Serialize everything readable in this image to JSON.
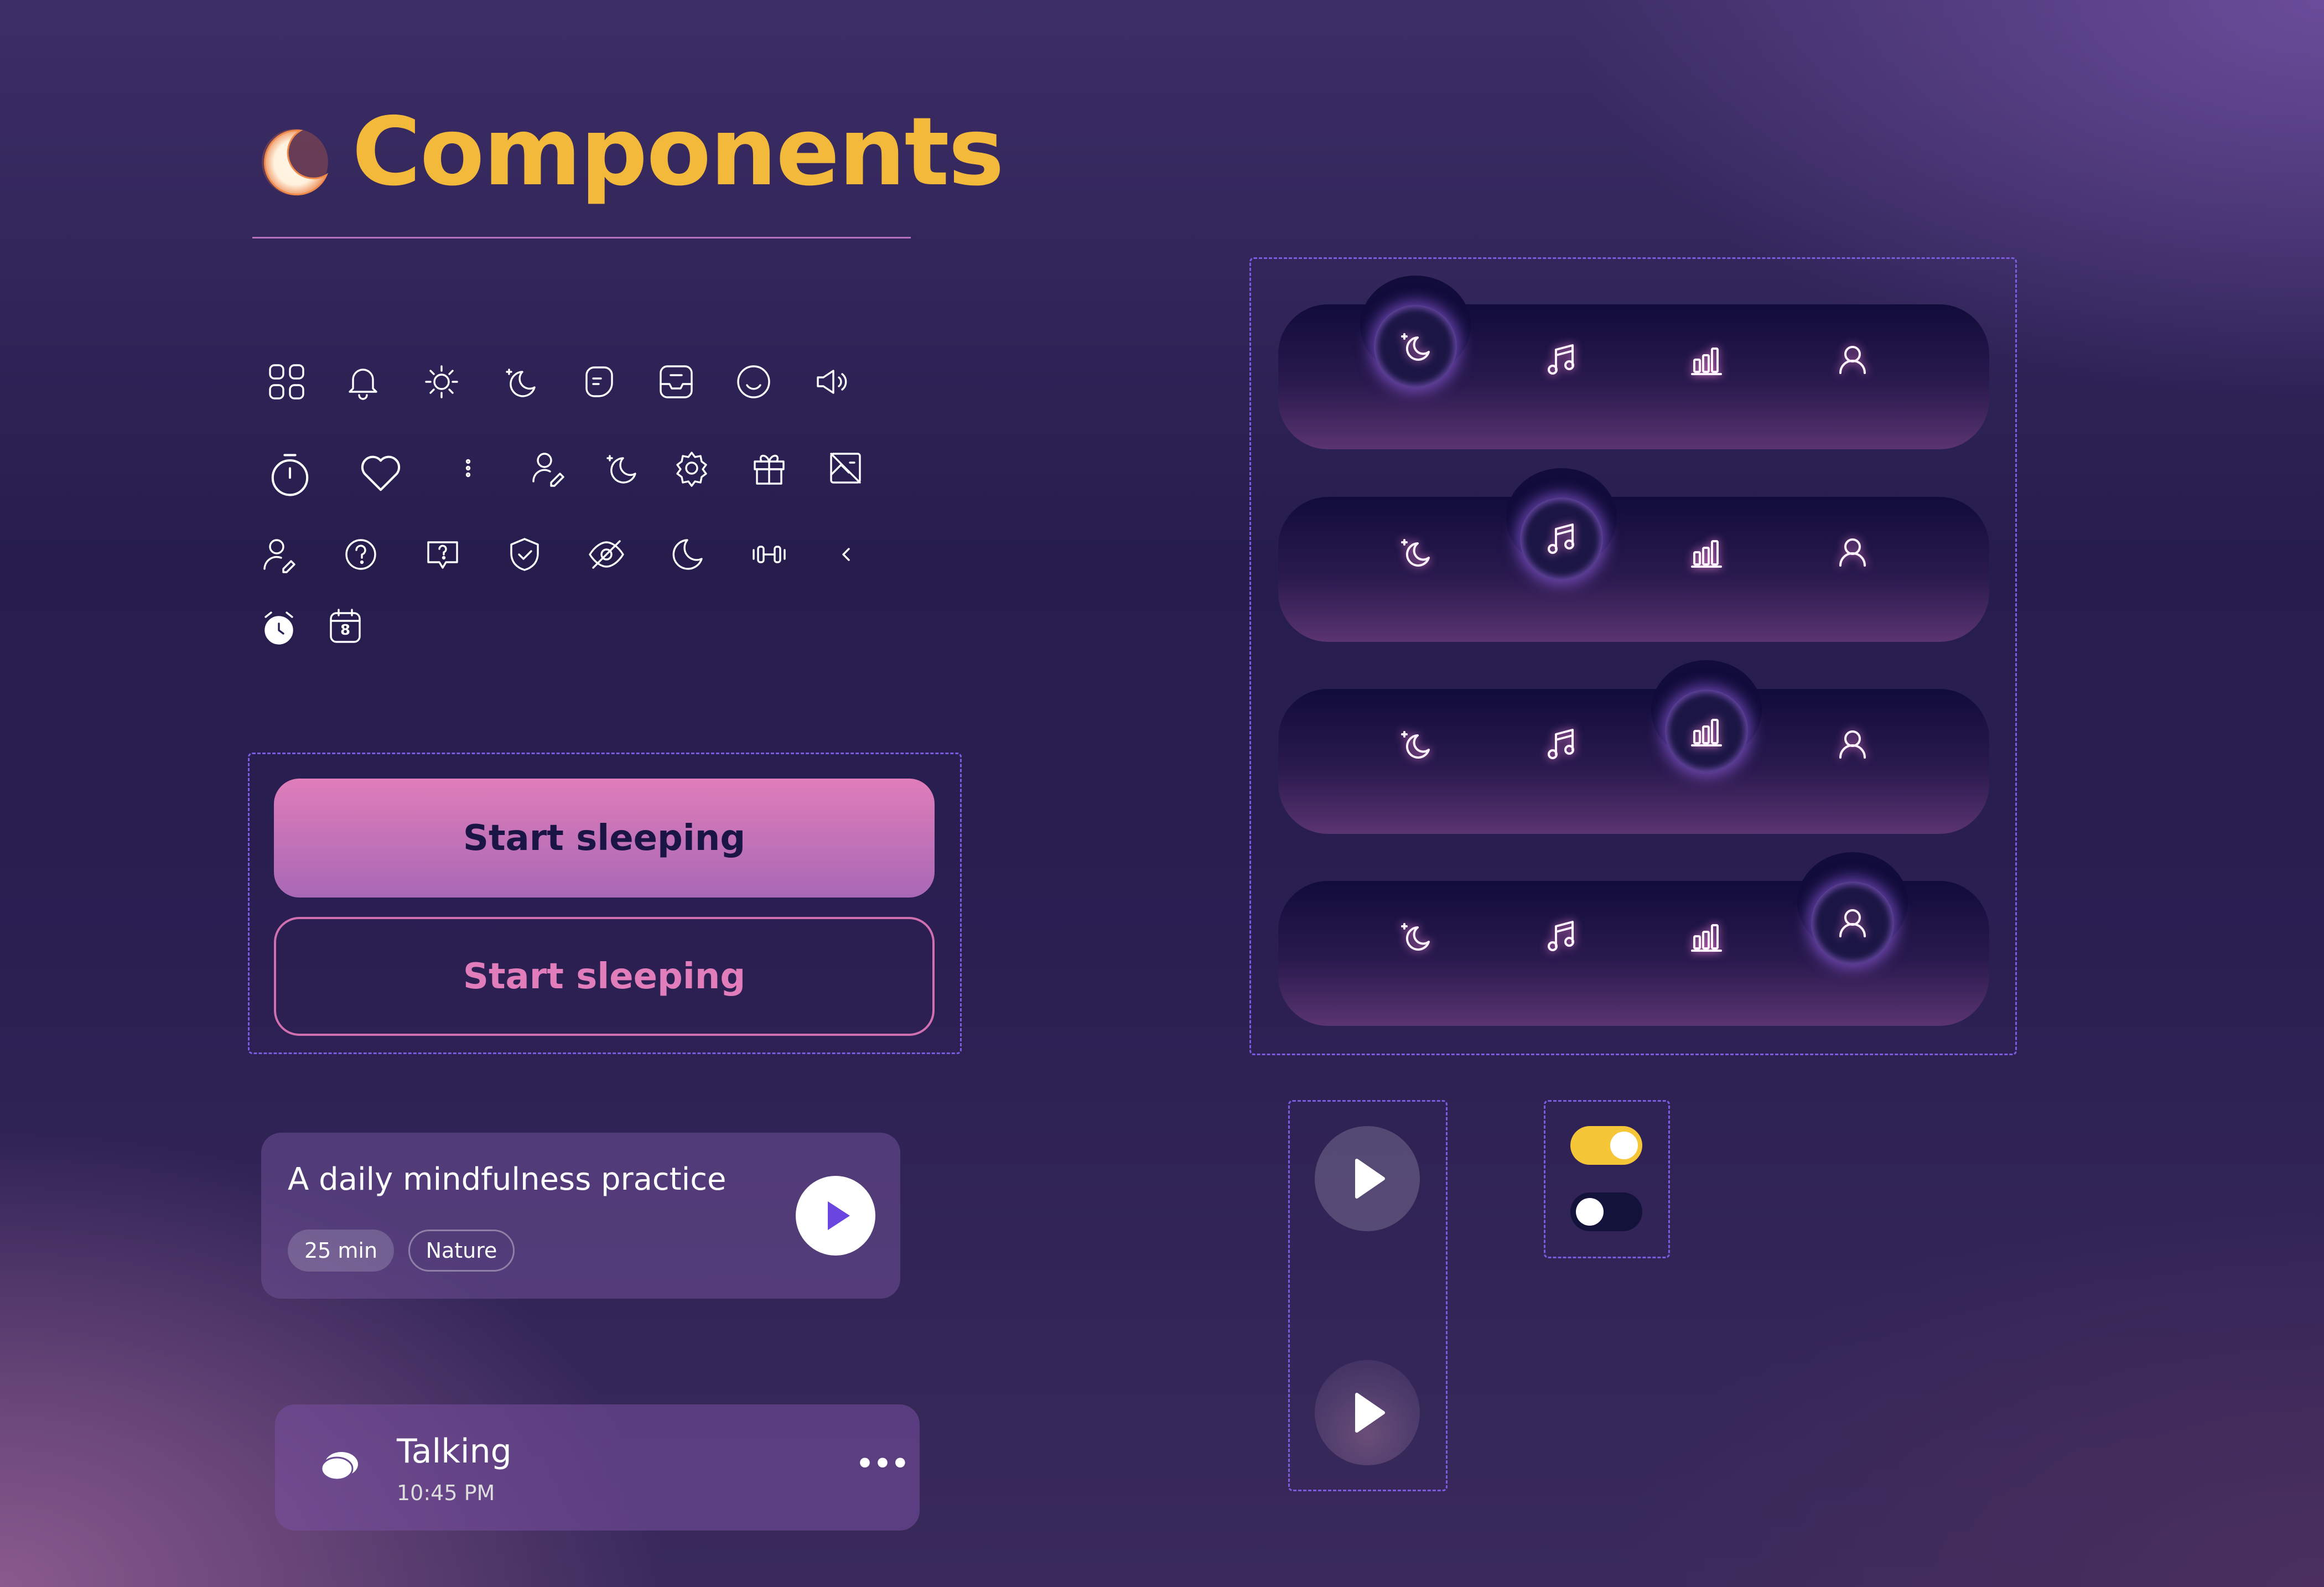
{
  "header": {
    "title": "Components",
    "moon_icon": "crescent-moon-icon"
  },
  "icon_grid": {
    "row1": [
      "grid-icon",
      "bell-icon",
      "sun-icon",
      "moon-star-icon",
      "sticker-icon",
      "inbox-icon",
      "smile-icon",
      "speaker-icon"
    ],
    "row2": [
      "timer-icon",
      "heart-icon",
      "more-vertical-icon",
      "user-edit-icon",
      "moon-star-icon",
      "settings-icon",
      "gift-icon",
      "image-icon"
    ],
    "row3": [
      "user-pen-icon",
      "help-circle-icon",
      "message-question-icon",
      "shield-check-icon",
      "eye-off-icon",
      "moon-icon",
      "dumbbell-icon",
      "chevron-left-icon"
    ],
    "row4": [
      "alarm-clock-icon",
      "calendar-icon"
    ],
    "calendar_day": "8"
  },
  "buttons": {
    "primary_label": "Start sleeping",
    "secondary_label": "Start sleeping"
  },
  "practice_card": {
    "title": "A daily mindfulness practice",
    "duration": "25 min",
    "tag": "Nature"
  },
  "talking_row": {
    "name": "Talking",
    "time": "10:45 PM",
    "more": "•••"
  },
  "nav_bars": {
    "items": [
      "sleep-icon",
      "music-icon",
      "stats-icon",
      "profile-icon"
    ],
    "active_indexes": [
      0,
      1,
      2,
      3
    ]
  },
  "toggles": [
    {
      "state": "on",
      "color": "#f5c638"
    },
    {
      "state": "off",
      "color": "#13123a"
    }
  ],
  "colors": {
    "accent_gold": "#f2b93b",
    "accent_pink": "#e07dba",
    "dashed": "#7b5ce0"
  }
}
